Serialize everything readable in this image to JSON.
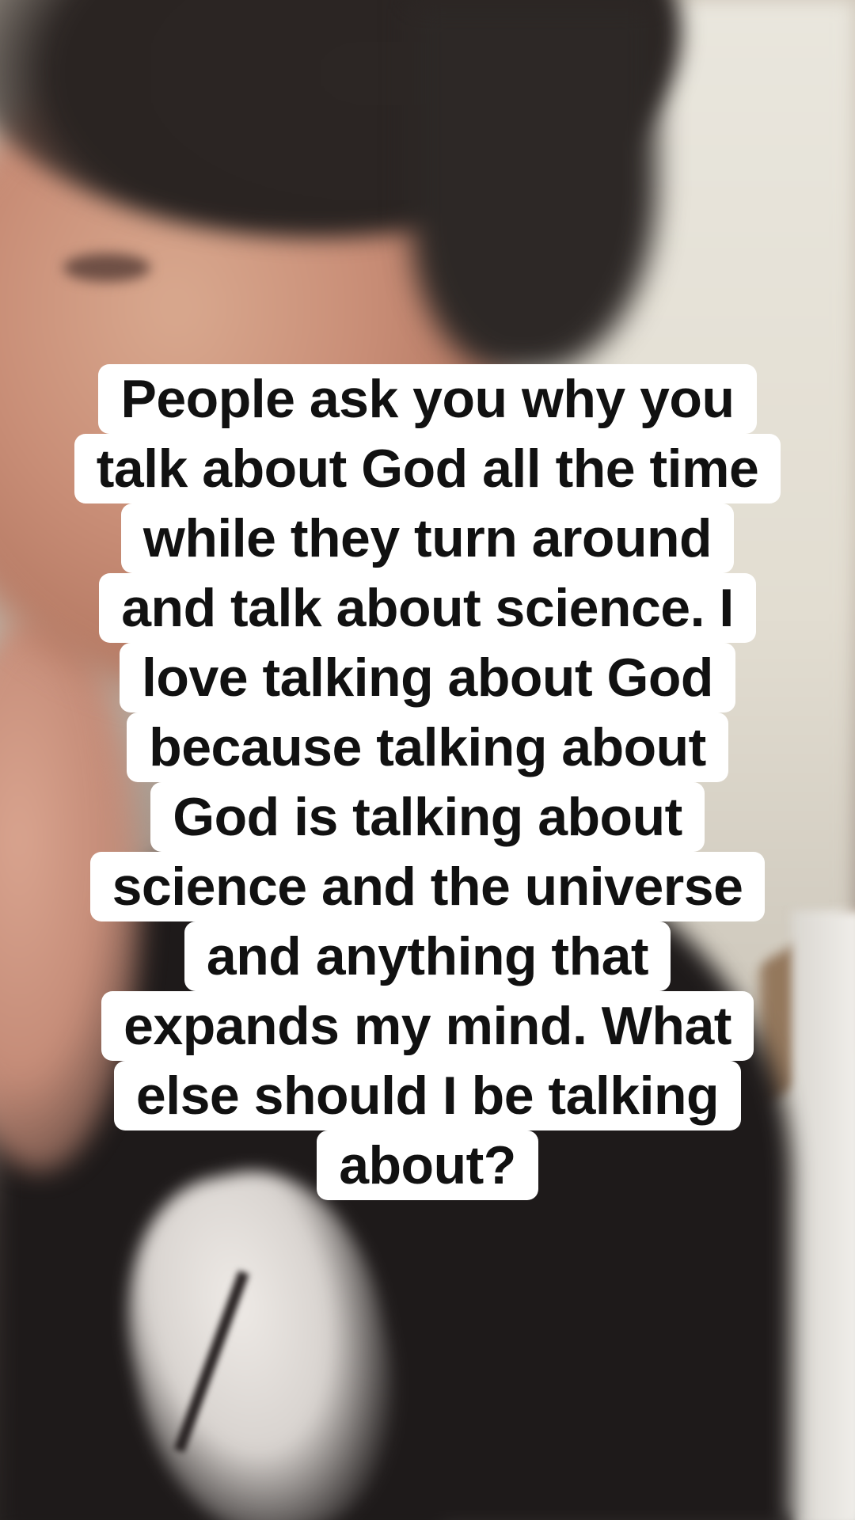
{
  "caption": {
    "lines": [
      "People ask you why you",
      "talk about God all the time",
      "while they turn around",
      "and talk about science. I",
      "love talking about God",
      "because talking about",
      "God is talking about",
      "science and the universe",
      "and anything that",
      "expands my mind. What",
      "else should I be talking",
      "about?"
    ]
  },
  "colors": {
    "caption_background": "#ffffff",
    "caption_text": "#111111"
  }
}
